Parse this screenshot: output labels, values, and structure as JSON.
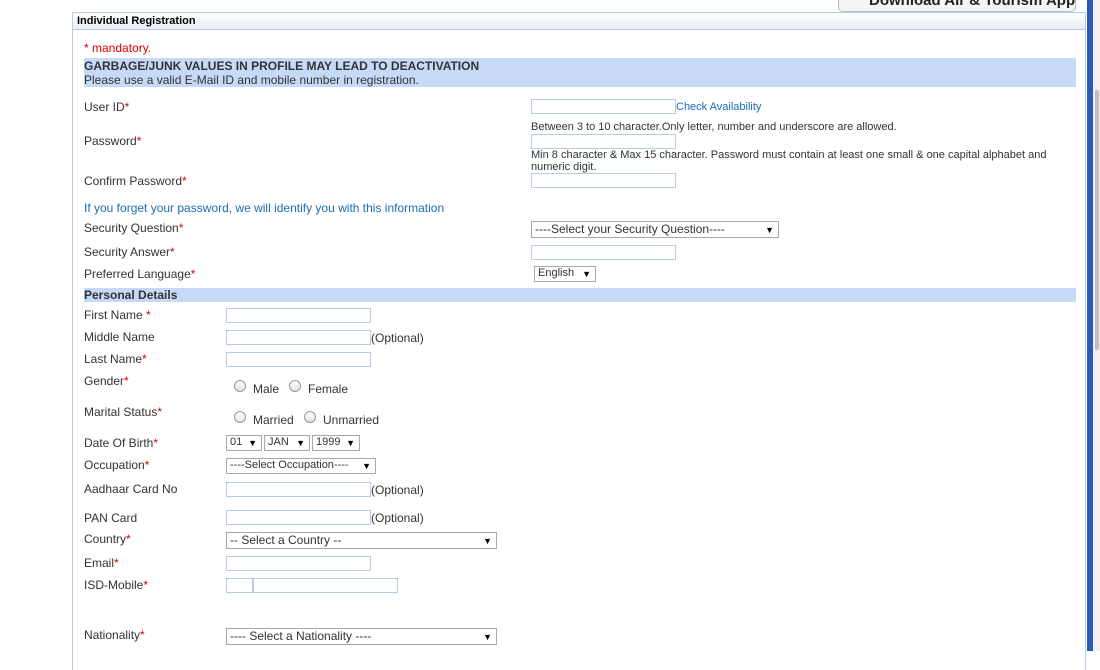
{
  "header": {
    "download_app_label": "Download Air & Tourism App",
    "panel_title": "Individual Registration"
  },
  "notice": {
    "mandatory": "* mandatory.",
    "warning_title": "GARBAGE/JUNK VALUES IN PROFILE MAY LEAD TO DEACTIVATION",
    "warning_sub": "Please use a valid E-Mail ID and mobile number in registration."
  },
  "account": {
    "user_id_label": "User ID",
    "check_availability": "Check Availability",
    "user_id_hint": "Between 3 to 10 character.Only letter, number and underscore are allowed.",
    "password_label": "Password",
    "password_hint_1": "Min 8 character & Max 15 character. Password must contain at least one small & one capital alphabet and",
    "password_hint_2": "numeric digit.",
    "confirm_password_label": "Confirm Password",
    "forgot_info": "If you forget your password, we will identify you with this information",
    "security_question_label": "Security Question",
    "security_question_value": "----Select your Security Question----",
    "security_answer_label": "Security Answer",
    "preferred_language_label": "Preferred Language",
    "preferred_language_value": "English"
  },
  "personal": {
    "section_title": "Personal Details",
    "first_name_label": "First Name",
    "middle_name_label": "Middle Name",
    "last_name_label": "Last Name",
    "optional": "(Optional)",
    "gender_label": "Gender",
    "gender_male": "Male",
    "gender_female": "Female",
    "marital_label": "Marital Status",
    "marital_married": "Married",
    "marital_unmarried": "Unmarried",
    "dob_label": "Date Of Birth",
    "dob_day": "01",
    "dob_month": "JAN",
    "dob_year": "1999",
    "occupation_label": "Occupation",
    "occupation_value": "----Select Occupation----",
    "aadhaar_label": "Aadhaar Card No",
    "pan_label": "PAN Card",
    "country_label": "Country",
    "country_value": "-- Select a Country --",
    "email_label": "Email",
    "isd_mobile_label": "ISD-Mobile",
    "nationality_label": "Nationality",
    "nationality_value": "---- Select a Nationality ----"
  },
  "required_mark": "*",
  "colors": {
    "accent_blue": "#1a6fb5",
    "required_red": "#d80000",
    "section_bg": "#c6d9f6",
    "right_bar": "#2a5bb6"
  }
}
